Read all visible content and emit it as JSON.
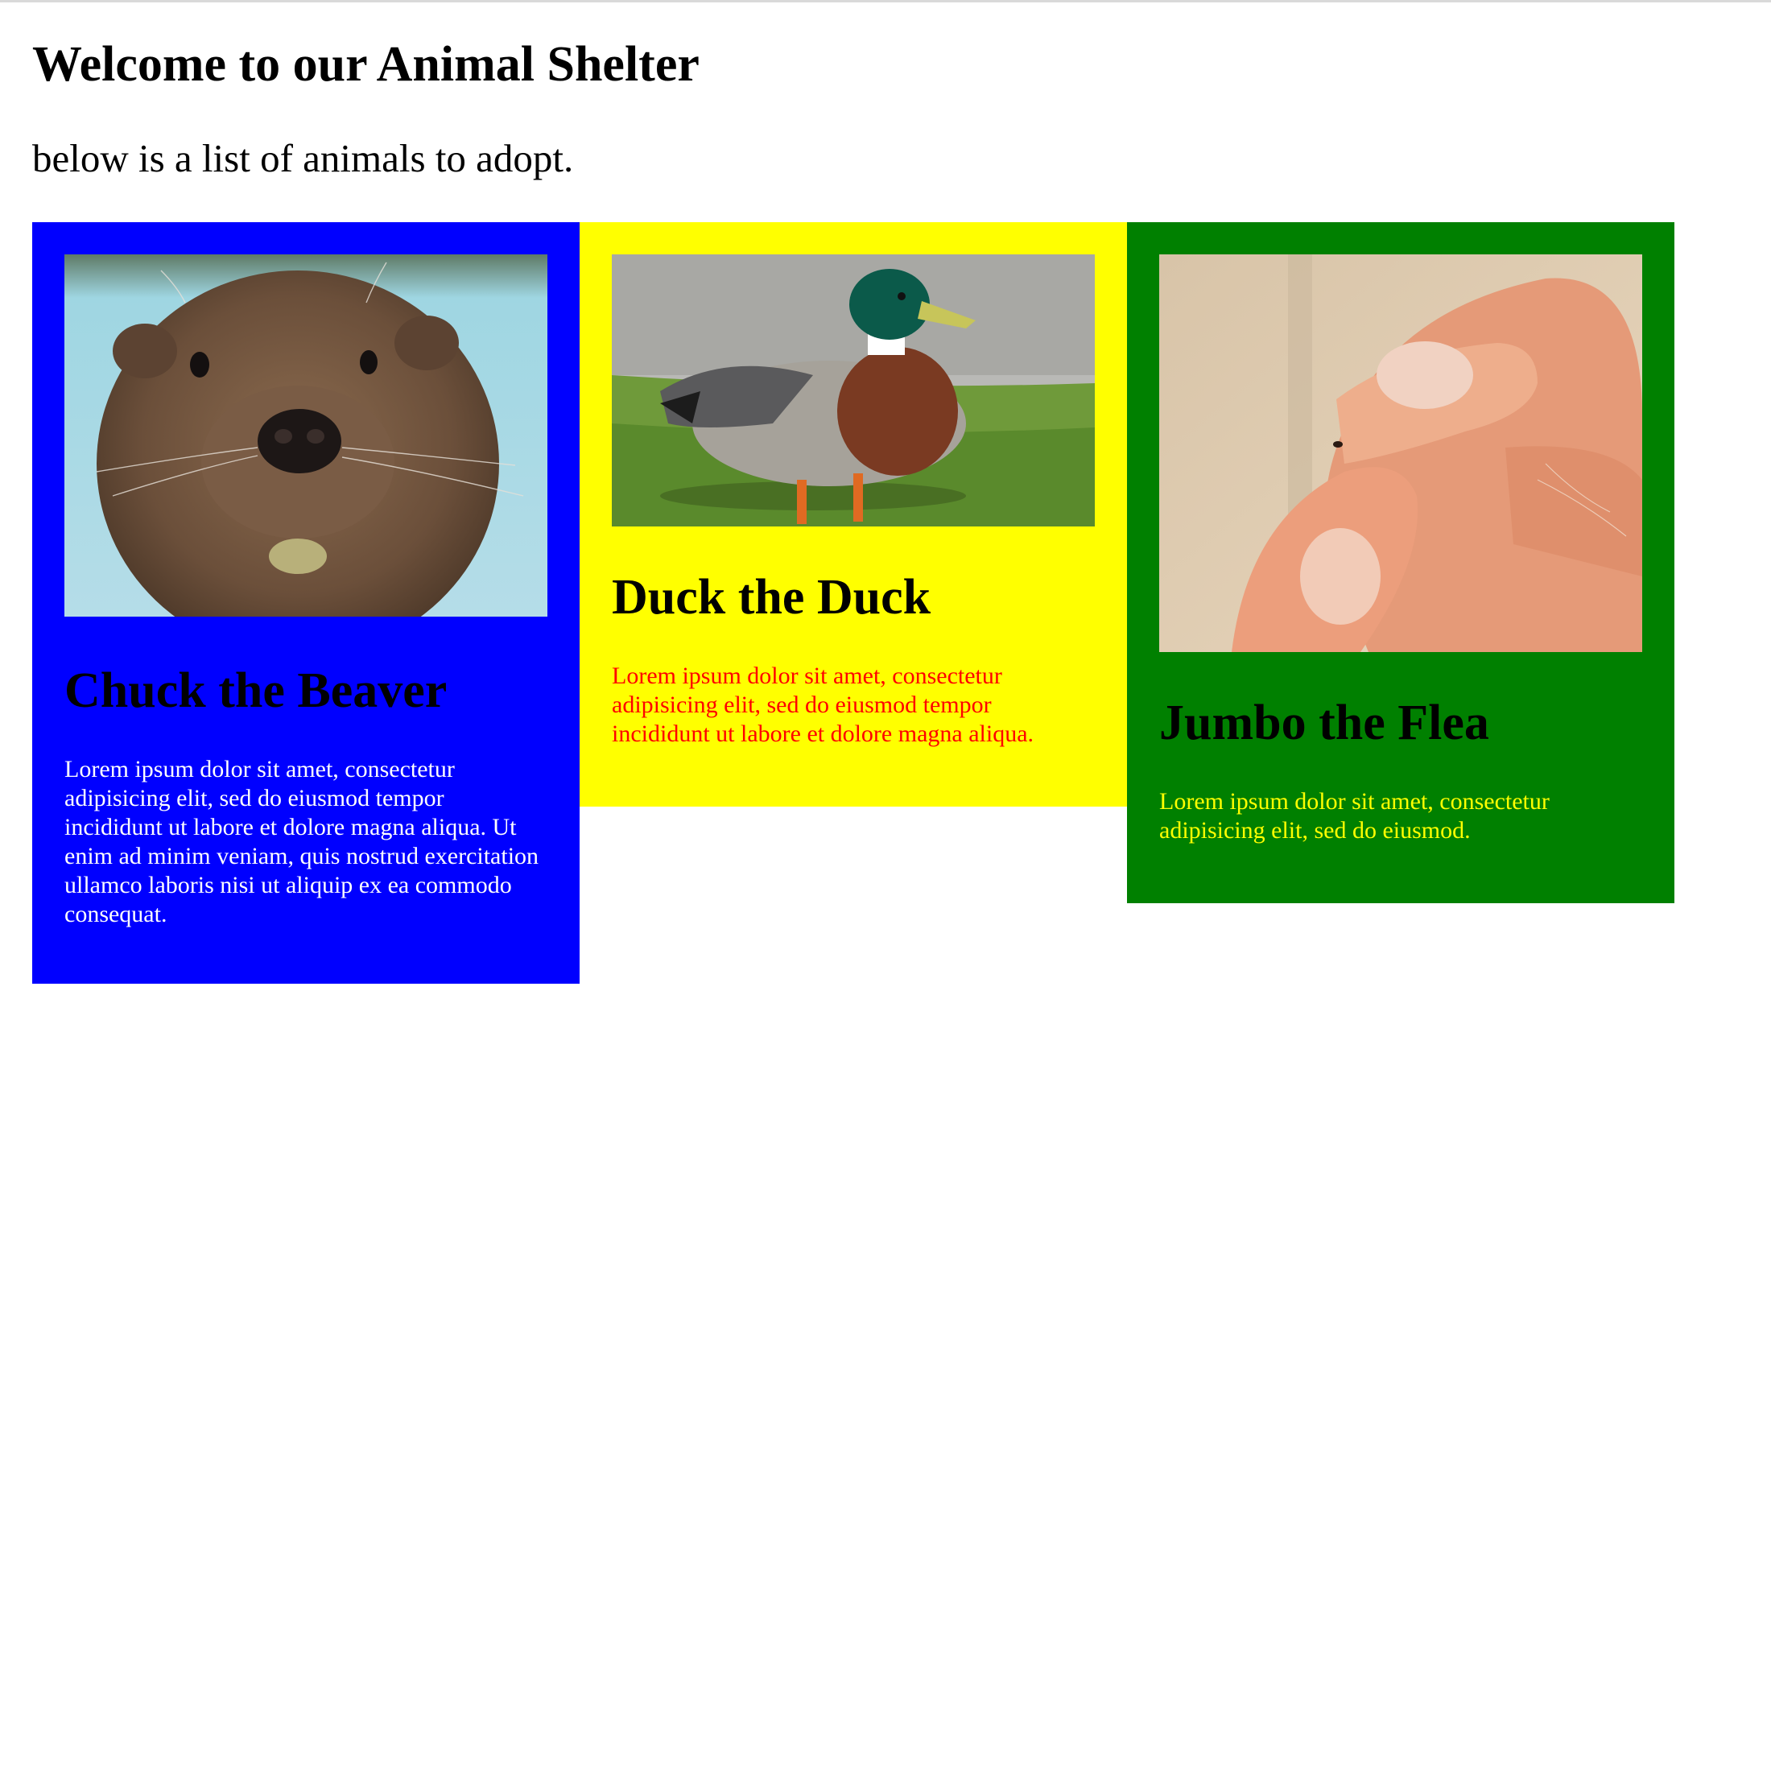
{
  "page": {
    "title": "Welcome to our Animal Shelter",
    "intro": "below is a list of animals to adopt."
  },
  "animals": [
    {
      "name": "Chuck the Beaver",
      "description": "Lorem ipsum dolor sit amet, consectetur adipisicing elit, sed do eiusmod tempor incididunt ut labore et dolore magna aliqua. Ut enim ad minim veniam, quis nostrud exercitation ullamco laboris nisi ut aliquip ex ea commodo consequat.",
      "card_color": "#0000ff",
      "text_color": "#ffffff",
      "photo": "beaver-photo"
    },
    {
      "name": "Duck the Duck",
      "description": "Lorem ipsum dolor sit amet, consectetur adipisicing elit, sed do eiusmod tempor incididunt ut labore et dolore magna aliqua.",
      "card_color": "#ffff00",
      "text_color": "#ff0000",
      "photo": "duck-photo"
    },
    {
      "name": "Jumbo the Flea",
      "description": "Lorem ipsum dolor sit amet, consectetur adipisicing elit, sed do eiusmod.",
      "card_color": "#008000",
      "text_color": "#ffff00",
      "photo": "flea-photo"
    }
  ]
}
